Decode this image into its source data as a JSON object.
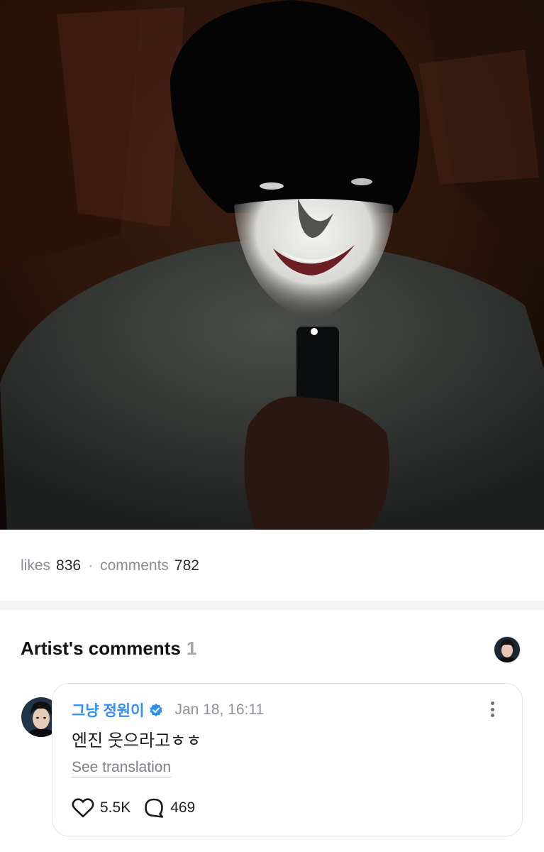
{
  "post": {
    "likes_label": "likes",
    "likes_count": "836",
    "separator": "·",
    "comments_label": "comments",
    "comments_count": "782"
  },
  "artist_comments": {
    "title": "Artist's comments",
    "count": "1"
  },
  "comment": {
    "author": "그냥 정원이",
    "date": "Jan 18, 16:11",
    "text": "엔진 웃으라고ㅎㅎ",
    "translate_label": "See translation",
    "like_count": "5.5K",
    "reply_count": "469"
  },
  "icons": {
    "verified": "verified-badge-icon",
    "more": "more-vertical-icon",
    "like": "heart-icon",
    "reply": "comment-bubble-icon"
  },
  "colors": {
    "author": "#2f8ff5",
    "verified": "#2f8ff5",
    "muted": "#8a8d93"
  }
}
